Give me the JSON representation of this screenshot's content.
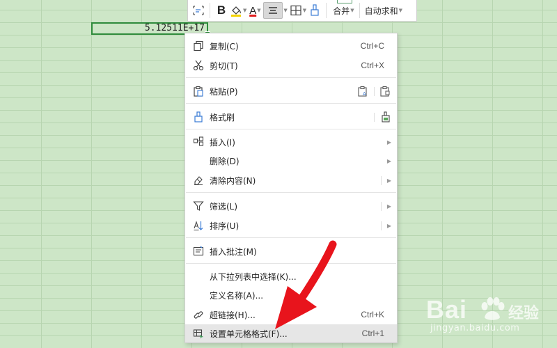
{
  "cell": {
    "value": "5.12511E+17"
  },
  "toolbar": {
    "bold_label": "B",
    "font_color_label": "A",
    "merge_label": "合并",
    "autosum_label": "自动求和"
  },
  "menu": {
    "copy": {
      "label": "复制(C)",
      "shortcut": "Ctrl+C"
    },
    "cut": {
      "label": "剪切(T)",
      "shortcut": "Ctrl+X"
    },
    "paste": {
      "label": "粘贴(P)"
    },
    "format_painter": {
      "label": "格式刷"
    },
    "insert": {
      "label": "插入(I)"
    },
    "delete": {
      "label": "删除(D)"
    },
    "clear": {
      "label": "清除内容(N)"
    },
    "filter": {
      "label": "筛选(L)"
    },
    "sort": {
      "label": "排序(U)"
    },
    "comment": {
      "label": "插入批注(M)"
    },
    "pick_list": {
      "label": "从下拉列表中选择(K)..."
    },
    "define_name": {
      "label": "定义名称(A)..."
    },
    "hyperlink": {
      "label": "超链接(H)...",
      "shortcut": "Ctrl+K"
    },
    "format_cells": {
      "label": "设置单元格格式(F)...",
      "shortcut": "Ctrl+1"
    }
  },
  "watermark": {
    "brand": "Bai",
    "brand_cn": "经验",
    "url": "jingyan.baidu.com"
  },
  "colors": {
    "sheet_bg": "#cde6c7",
    "gridline": "#b7d5b0",
    "selection": "#2e8b3b",
    "arrow": "#e8141c",
    "highlight": "#e6e6e6"
  }
}
